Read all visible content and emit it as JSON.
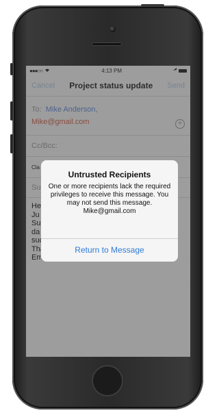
{
  "status_bar": {
    "signal": "●●●○○",
    "time": "4:13 PM"
  },
  "compose": {
    "cancel_label": "Cancel",
    "title": "Project status update",
    "send_label": "Send",
    "to_label": "To:",
    "recipient_1": "Mike Anderson,",
    "recipient_2": "Mike@gmail.com",
    "cc_label": "Cc/Bcc:",
    "classification_partial": "Cla",
    "subject_partial": "Su",
    "body": "He\nJu\nSu\nda\nsuccessful launch!\nThanks,\nEmma"
  },
  "alert": {
    "title": "Untrusted Recipients",
    "message": "One or more recipients lack the required privileges to receive this message. You may not send this message.",
    "address": "Mike@gmail.com",
    "button_label": "Return to Message"
  },
  "colors": {
    "accent": "#2f7ad6",
    "untrusted": "#c05a45",
    "recipient": "#5a7fc4"
  }
}
